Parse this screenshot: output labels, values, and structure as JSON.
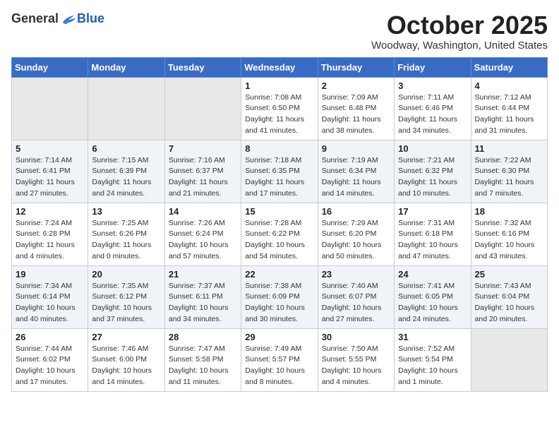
{
  "header": {
    "logo": {
      "general": "General",
      "blue": "Blue"
    },
    "title": "October 2025",
    "location": "Woodway, Washington, United States"
  },
  "weekdays": [
    "Sunday",
    "Monday",
    "Tuesday",
    "Wednesday",
    "Thursday",
    "Friday",
    "Saturday"
  ],
  "weeks": [
    {
      "days": [
        {
          "number": "",
          "empty": true
        },
        {
          "number": "",
          "empty": true
        },
        {
          "number": "",
          "empty": true
        },
        {
          "number": "1",
          "sunrise": "Sunrise: 7:08 AM",
          "sunset": "Sunset: 6:50 PM",
          "daylight": "Daylight: 11 hours and 41 minutes."
        },
        {
          "number": "2",
          "sunrise": "Sunrise: 7:09 AM",
          "sunset": "Sunset: 6:48 PM",
          "daylight": "Daylight: 11 hours and 38 minutes."
        },
        {
          "number": "3",
          "sunrise": "Sunrise: 7:11 AM",
          "sunset": "Sunset: 6:46 PM",
          "daylight": "Daylight: 11 hours and 34 minutes."
        },
        {
          "number": "4",
          "sunrise": "Sunrise: 7:12 AM",
          "sunset": "Sunset: 6:44 PM",
          "daylight": "Daylight: 11 hours and 31 minutes."
        }
      ]
    },
    {
      "days": [
        {
          "number": "5",
          "sunrise": "Sunrise: 7:14 AM",
          "sunset": "Sunset: 6:41 PM",
          "daylight": "Daylight: 11 hours and 27 minutes."
        },
        {
          "number": "6",
          "sunrise": "Sunrise: 7:15 AM",
          "sunset": "Sunset: 6:39 PM",
          "daylight": "Daylight: 11 hours and 24 minutes."
        },
        {
          "number": "7",
          "sunrise": "Sunrise: 7:16 AM",
          "sunset": "Sunset: 6:37 PM",
          "daylight": "Daylight: 11 hours and 21 minutes."
        },
        {
          "number": "8",
          "sunrise": "Sunrise: 7:18 AM",
          "sunset": "Sunset: 6:35 PM",
          "daylight": "Daylight: 11 hours and 17 minutes."
        },
        {
          "number": "9",
          "sunrise": "Sunrise: 7:19 AM",
          "sunset": "Sunset: 6:34 PM",
          "daylight": "Daylight: 11 hours and 14 minutes."
        },
        {
          "number": "10",
          "sunrise": "Sunrise: 7:21 AM",
          "sunset": "Sunset: 6:32 PM",
          "daylight": "Daylight: 11 hours and 10 minutes."
        },
        {
          "number": "11",
          "sunrise": "Sunrise: 7:22 AM",
          "sunset": "Sunset: 6:30 PM",
          "daylight": "Daylight: 11 hours and 7 minutes."
        }
      ]
    },
    {
      "days": [
        {
          "number": "12",
          "sunrise": "Sunrise: 7:24 AM",
          "sunset": "Sunset: 6:28 PM",
          "daylight": "Daylight: 11 hours and 4 minutes."
        },
        {
          "number": "13",
          "sunrise": "Sunrise: 7:25 AM",
          "sunset": "Sunset: 6:26 PM",
          "daylight": "Daylight: 11 hours and 0 minutes."
        },
        {
          "number": "14",
          "sunrise": "Sunrise: 7:26 AM",
          "sunset": "Sunset: 6:24 PM",
          "daylight": "Daylight: 10 hours and 57 minutes."
        },
        {
          "number": "15",
          "sunrise": "Sunrise: 7:28 AM",
          "sunset": "Sunset: 6:22 PM",
          "daylight": "Daylight: 10 hours and 54 minutes."
        },
        {
          "number": "16",
          "sunrise": "Sunrise: 7:29 AM",
          "sunset": "Sunset: 6:20 PM",
          "daylight": "Daylight: 10 hours and 50 minutes."
        },
        {
          "number": "17",
          "sunrise": "Sunrise: 7:31 AM",
          "sunset": "Sunset: 6:18 PM",
          "daylight": "Daylight: 10 hours and 47 minutes."
        },
        {
          "number": "18",
          "sunrise": "Sunrise: 7:32 AM",
          "sunset": "Sunset: 6:16 PM",
          "daylight": "Daylight: 10 hours and 43 minutes."
        }
      ]
    },
    {
      "days": [
        {
          "number": "19",
          "sunrise": "Sunrise: 7:34 AM",
          "sunset": "Sunset: 6:14 PM",
          "daylight": "Daylight: 10 hours and 40 minutes."
        },
        {
          "number": "20",
          "sunrise": "Sunrise: 7:35 AM",
          "sunset": "Sunset: 6:12 PM",
          "daylight": "Daylight: 10 hours and 37 minutes."
        },
        {
          "number": "21",
          "sunrise": "Sunrise: 7:37 AM",
          "sunset": "Sunset: 6:11 PM",
          "daylight": "Daylight: 10 hours and 34 minutes."
        },
        {
          "number": "22",
          "sunrise": "Sunrise: 7:38 AM",
          "sunset": "Sunset: 6:09 PM",
          "daylight": "Daylight: 10 hours and 30 minutes."
        },
        {
          "number": "23",
          "sunrise": "Sunrise: 7:40 AM",
          "sunset": "Sunset: 6:07 PM",
          "daylight": "Daylight: 10 hours and 27 minutes."
        },
        {
          "number": "24",
          "sunrise": "Sunrise: 7:41 AM",
          "sunset": "Sunset: 6:05 PM",
          "daylight": "Daylight: 10 hours and 24 minutes."
        },
        {
          "number": "25",
          "sunrise": "Sunrise: 7:43 AM",
          "sunset": "Sunset: 6:04 PM",
          "daylight": "Daylight: 10 hours and 20 minutes."
        }
      ]
    },
    {
      "days": [
        {
          "number": "26",
          "sunrise": "Sunrise: 7:44 AM",
          "sunset": "Sunset: 6:02 PM",
          "daylight": "Daylight: 10 hours and 17 minutes."
        },
        {
          "number": "27",
          "sunrise": "Sunrise: 7:46 AM",
          "sunset": "Sunset: 6:00 PM",
          "daylight": "Daylight: 10 hours and 14 minutes."
        },
        {
          "number": "28",
          "sunrise": "Sunrise: 7:47 AM",
          "sunset": "Sunset: 5:58 PM",
          "daylight": "Daylight: 10 hours and 11 minutes."
        },
        {
          "number": "29",
          "sunrise": "Sunrise: 7:49 AM",
          "sunset": "Sunset: 5:57 PM",
          "daylight": "Daylight: 10 hours and 8 minutes."
        },
        {
          "number": "30",
          "sunrise": "Sunrise: 7:50 AM",
          "sunset": "Sunset: 5:55 PM",
          "daylight": "Daylight: 10 hours and 4 minutes."
        },
        {
          "number": "31",
          "sunrise": "Sunrise: 7:52 AM",
          "sunset": "Sunset: 5:54 PM",
          "daylight": "Daylight: 10 hours and 1 minute."
        },
        {
          "number": "",
          "empty": true
        }
      ]
    }
  ]
}
